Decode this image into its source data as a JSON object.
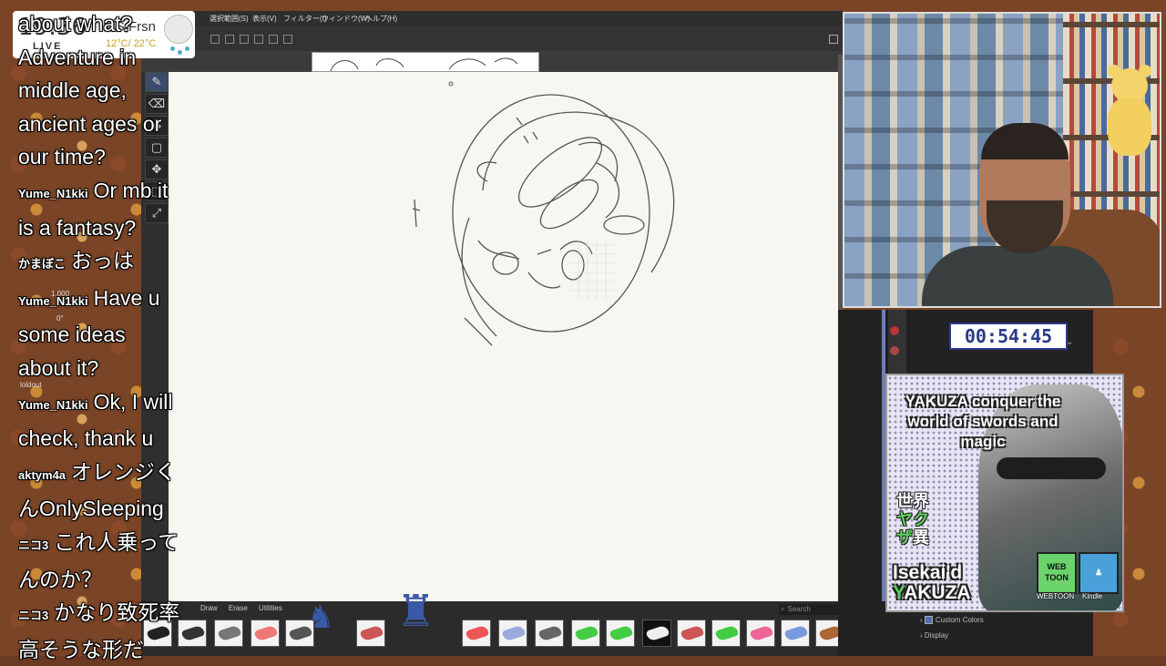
{
  "clock": {
    "time": "19:36",
    "live": "LIVE",
    "location": "US,Frsn",
    "temperature": "12°C/ 22°C"
  },
  "app": {
    "menu": [
      "選択範囲(S)",
      "表示(V)",
      "フィルター(I)",
      "ウィンドウ(W)",
      "ヘルプ(H)"
    ]
  },
  "brush_panel": {
    "tabs": [
      "Draw",
      "Erase",
      "Utilities"
    ],
    "search_placeholder": "Search"
  },
  "chat": {
    "messages": [
      {
        "user": "",
        "text": "about what?"
      },
      {
        "user": "",
        "text": "Adventure in"
      },
      {
        "user": "",
        "text": "middle age,"
      },
      {
        "user": "",
        "text": "ancient ages or"
      },
      {
        "user": "",
        "text": "our time?"
      },
      {
        "user": "Yume_N1kki",
        "text": "Or mb it"
      },
      {
        "user": "",
        "text": "is a fantasy?"
      },
      {
        "user": "かまぼこ",
        "text": "おっは"
      },
      {
        "user": "Yume_N1kki",
        "text": "Have u"
      },
      {
        "user": "",
        "text": "some ideas"
      },
      {
        "user": "",
        "text": "about it?"
      },
      {
        "user": "Yume_N1kki",
        "text": "Ok, I will"
      },
      {
        "user": "",
        "text": "check, thank u"
      },
      {
        "user": "aktym4a",
        "text": "オレンジく"
      },
      {
        "user": "",
        "text": "んOnlySleeping"
      },
      {
        "user": "ニコ3",
        "text": "これ人乗って"
      },
      {
        "user": "",
        "text": "んのか？"
      },
      {
        "user": "ニコ3",
        "text": "かなり致死率"
      },
      {
        "user": "",
        "text": "高そうな形だ"
      }
    ]
  },
  "layer_fragments": {
    "opacity": "1.000",
    "angle": "0°",
    "label": "loldout"
  },
  "timer": {
    "value": "00:54:45"
  },
  "right_panel": {
    "custom_colors": "Custom Colors",
    "display": "Display"
  },
  "ad": {
    "title": "YAKUZA conquer the world of swords and magic",
    "jp_prefix": "世界",
    "jp_highlight": "ヤクザ",
    "jp_suffix": "異",
    "isekai_line": "Isekai'd",
    "yakuza_y": "Y",
    "yakuza_rest": "AKUZA",
    "webtoon_badge": "WEB TOON",
    "webtoon_label": "WEBTOON",
    "kindle_label": "Kindle"
  },
  "colors": {
    "accent": "#3a4c6a",
    "timer": "#2b3a8a",
    "webtoon": "#6bd36b"
  }
}
